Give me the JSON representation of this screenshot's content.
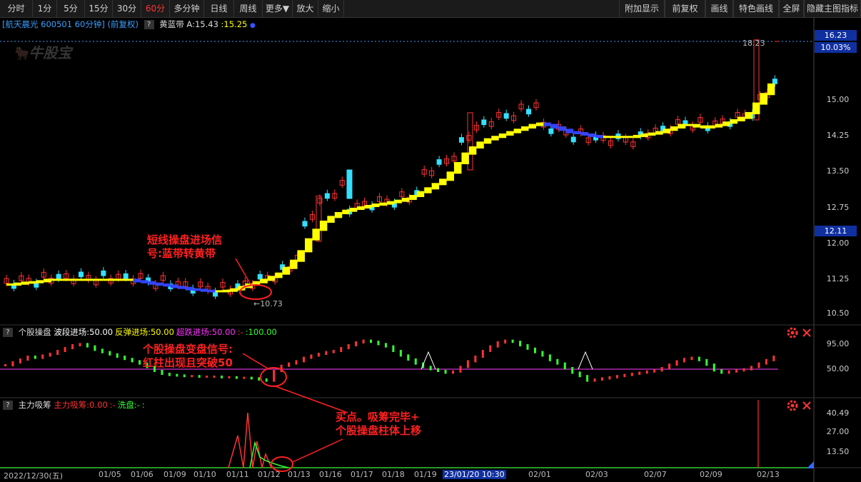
{
  "toolbar": {
    "periods": [
      "分时",
      "1分",
      "5分",
      "15分",
      "30分",
      "60分",
      "多分钟",
      "日线",
      "周线",
      "更多▼",
      "放大",
      "缩小"
    ],
    "active": "60分",
    "right": [
      "附加显示",
      "前复权",
      "画线",
      "特色画线",
      "全屏",
      "隐藏主图指标"
    ]
  },
  "header": {
    "stock": "[航天晨光 600501 60分钟] (前复权)",
    "indicator_name": "黄蓝带",
    "indicator_value_a": "A:15.43",
    "indicator_value_b": ":15.25"
  },
  "watermark": "牛股宝",
  "price_axis": {
    "labels": [
      "15.00",
      "14.25",
      "13.50",
      "12.75",
      "12.00",
      "11.25",
      "10.50"
    ],
    "top_price": "16.23",
    "top_pct": "10.03%",
    "cur_price": "12.11",
    "max_label": "18.23",
    "min_label": "10.73"
  },
  "panel1": {
    "name": "个股操盘",
    "items": [
      {
        "text": "波段进场:50.00",
        "color": "#ffffff"
      },
      {
        "text": "反弹进场:50.00",
        "color": "#ffff00"
      },
      {
        "text": "超跌进场:50.00",
        "color": "#ff33ff"
      },
      {
        "text": ":-",
        "color": "#ff3333"
      },
      {
        "text": ":100.00",
        "color": "#33ff33"
      }
    ],
    "axis": [
      "95.00",
      "50.00"
    ]
  },
  "panel2": {
    "name": "主力吸筹",
    "items": [
      {
        "text": "主力吸筹:0.00",
        "color": "#ff3333"
      },
      {
        "text": ":-",
        "color": "#ff3333"
      },
      {
        "text": "洗盘:-",
        "color": "#33ff33"
      },
      {
        "text": ":",
        "color": "#33ff33"
      }
    ],
    "axis": [
      "40.49",
      "27.00",
      "13.50"
    ]
  },
  "dates": [
    "2022/12/30(五)",
    "01/05",
    "01/06",
    "01/09",
    "01/10",
    "01/11",
    "01/12",
    "01/13",
    "01/16",
    "01/17",
    "01/18",
    "01/19",
    "23/01/20 10:30",
    "02/01",
    "02/03",
    "02/07",
    "02/09",
    "02/13"
  ],
  "annotations": {
    "a1": [
      "短线操盘进场信",
      "号:蓝带转黄带"
    ],
    "a2": [
      "个股操盘变盘信号:",
      "红柱出现且突破50"
    ],
    "a3": [
      "买点。吸筹完毕+",
      "个股操盘柱体上移"
    ]
  },
  "colors": {
    "up": "#ff3333",
    "down": "#33e0ff",
    "band": "#ffff00",
    "blue": "#3344ff"
  },
  "chart_data": {
    "type": "candlestick",
    "band_fill": [
      11.1,
      11.1,
      11.12,
      11.14,
      11.15,
      11.17,
      11.2,
      11.2,
      11.2,
      11.2,
      11.2,
      11.2,
      11.2,
      11.2,
      11.2,
      11.2,
      11.2,
      11.2,
      11.17,
      11.15,
      11.12,
      11.1,
      11.08,
      11.05,
      11.03,
      11.0,
      10.99,
      10.97,
      10.96,
      10.96,
      10.97,
      11.0,
      11.05,
      11.1,
      11.15,
      11.2,
      11.26,
      11.33,
      11.45,
      11.6,
      11.8,
      12.05,
      12.25,
      12.42,
      12.52,
      12.6,
      12.65,
      12.69,
      12.72,
      12.75,
      12.78,
      12.8,
      12.83,
      12.86,
      12.9,
      12.96,
      13.04,
      13.12,
      13.21,
      13.3,
      13.45,
      13.65,
      13.85,
      13.98,
      14.08,
      14.15,
      14.2,
      14.25,
      14.3,
      14.35,
      14.4,
      14.45,
      14.48,
      14.45,
      14.4,
      14.35,
      14.3,
      14.28,
      14.25,
      14.22,
      14.2,
      14.2,
      14.2,
      14.2,
      14.2,
      14.22,
      14.25,
      14.27,
      14.3,
      14.35,
      14.4,
      14.45,
      14.45,
      14.42,
      14.4,
      14.42,
      14.45,
      14.5,
      14.55,
      14.6,
      14.7,
      14.9,
      15.1,
      15.3
    ]
  }
}
